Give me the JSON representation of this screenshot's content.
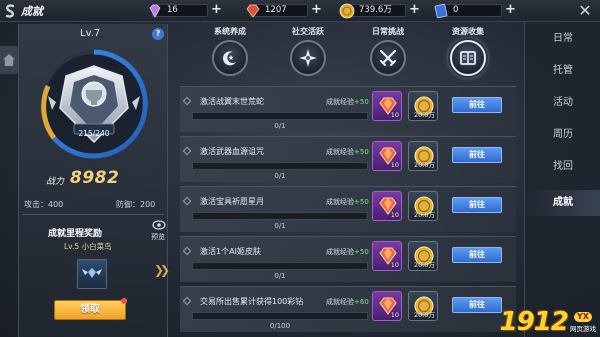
{
  "header": {
    "title": "成就",
    "resources": [
      {
        "icon": "purple-diamond-icon",
        "value": "16"
      },
      {
        "icon": "red-gem-icon",
        "value": "1207"
      },
      {
        "icon": "gold-coin-icon",
        "value": "739.6万"
      },
      {
        "icon": "blue-card-icon",
        "value": "0"
      }
    ],
    "plus": "+",
    "close": "✕"
  },
  "profile": {
    "level": "Lv.7",
    "help": "?",
    "exp_progress": "215/240",
    "power_label": "战力",
    "power_value": "8982",
    "attack": "攻击：400",
    "defense": "防御：200"
  },
  "milestone": {
    "title": "成就里程奖励",
    "subtitle": "Lv.5  小白菜鸟",
    "preview": "预览",
    "claim": "领取"
  },
  "categories": [
    {
      "label": "系统养成",
      "icon": "moon-star-icon"
    },
    {
      "label": "社交活跃",
      "icon": "compass-star-icon"
    },
    {
      "label": "日常挑战",
      "icon": "crossed-swords-icon"
    },
    {
      "label": "资源收集",
      "icon": "book-icon"
    }
  ],
  "exp_label": "成就经验",
  "tasks": [
    {
      "name": "激活战翼末世荒蛇",
      "exp": "+50",
      "progress": "0/1",
      "gem_qty": "10",
      "coin_qty": "20.0万",
      "button": "前往"
    },
    {
      "name": "激活武器血源诅咒",
      "exp": "+50",
      "progress": "0/1",
      "gem_qty": "10",
      "coin_qty": "20.0万",
      "button": "前往"
    },
    {
      "name": "激活宝具祈愿星月",
      "exp": "+50",
      "progress": "0/1",
      "gem_qty": "10",
      "coin_qty": "20.0万",
      "button": "前往"
    },
    {
      "name": "激活1个AI姬皮肤",
      "exp": "+50",
      "progress": "0/1",
      "gem_qty": "10",
      "coin_qty": "20.0万",
      "button": "前往"
    },
    {
      "name": "交易所出售累计获得100彩钻",
      "exp": "+60",
      "progress": "0/100",
      "gem_qty": "10",
      "coin_qty": "20.0万",
      "button": "前往"
    }
  ],
  "tabs": [
    "日常",
    "托管",
    "活动",
    "周历",
    "找回",
    "成就"
  ],
  "watermark": {
    "number": "1912",
    "badge": "YX",
    "sub": "网页游戏"
  }
}
